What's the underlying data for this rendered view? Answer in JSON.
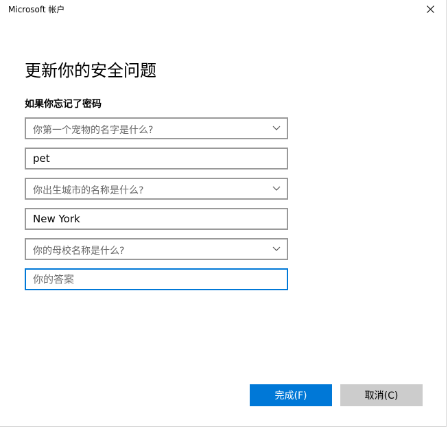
{
  "window": {
    "title": "Microsoft 帐户",
    "close_icon": "close-icon"
  },
  "main": {
    "heading": "更新你的安全问题",
    "subheading": "如果你忘记了密码"
  },
  "questions": [
    {
      "question": "你第一个宠物的名字是什么?",
      "answer_value": "pet",
      "answer_placeholder": ""
    },
    {
      "question": "你出生城市的名称是什么?",
      "answer_value": "New York",
      "answer_placeholder": ""
    },
    {
      "question": "你的母校名称是什么?",
      "answer_value": "",
      "answer_placeholder": "你的答案"
    }
  ],
  "buttons": {
    "done_label": "完成(F)",
    "cancel_label": "取消(C)"
  },
  "colors": {
    "accent": "#0078d7",
    "secondary_button": "#cccccc",
    "field_border": "#999999"
  },
  "icons": {
    "dropdown": "chevron-down-icon"
  }
}
